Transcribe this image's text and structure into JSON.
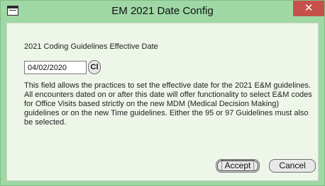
{
  "window": {
    "title": "EM 2021 Date Config",
    "close_label": "✕"
  },
  "form": {
    "field_label": "2021 Coding Guidelines Effective Date",
    "date_value": "04/02/2020",
    "calendar_button_label": "Cl",
    "description": "This field allows the practices to set the effective date for the 2021 E&M guidelines. All encounters dated on or after this date will offer functionality to select E&M codes for Office Visits based strictly on the new MDM (Medical Decision Making) guidelines or on the new Time guidelines. Either the 95 or 97 Guidelines must also be selected."
  },
  "buttons": {
    "accept_label": "Accept",
    "cancel_label": "Cancel"
  },
  "colors": {
    "frame": "#9fd8a5",
    "client_background": "#eef6e9",
    "close_button": "#c6504a"
  }
}
